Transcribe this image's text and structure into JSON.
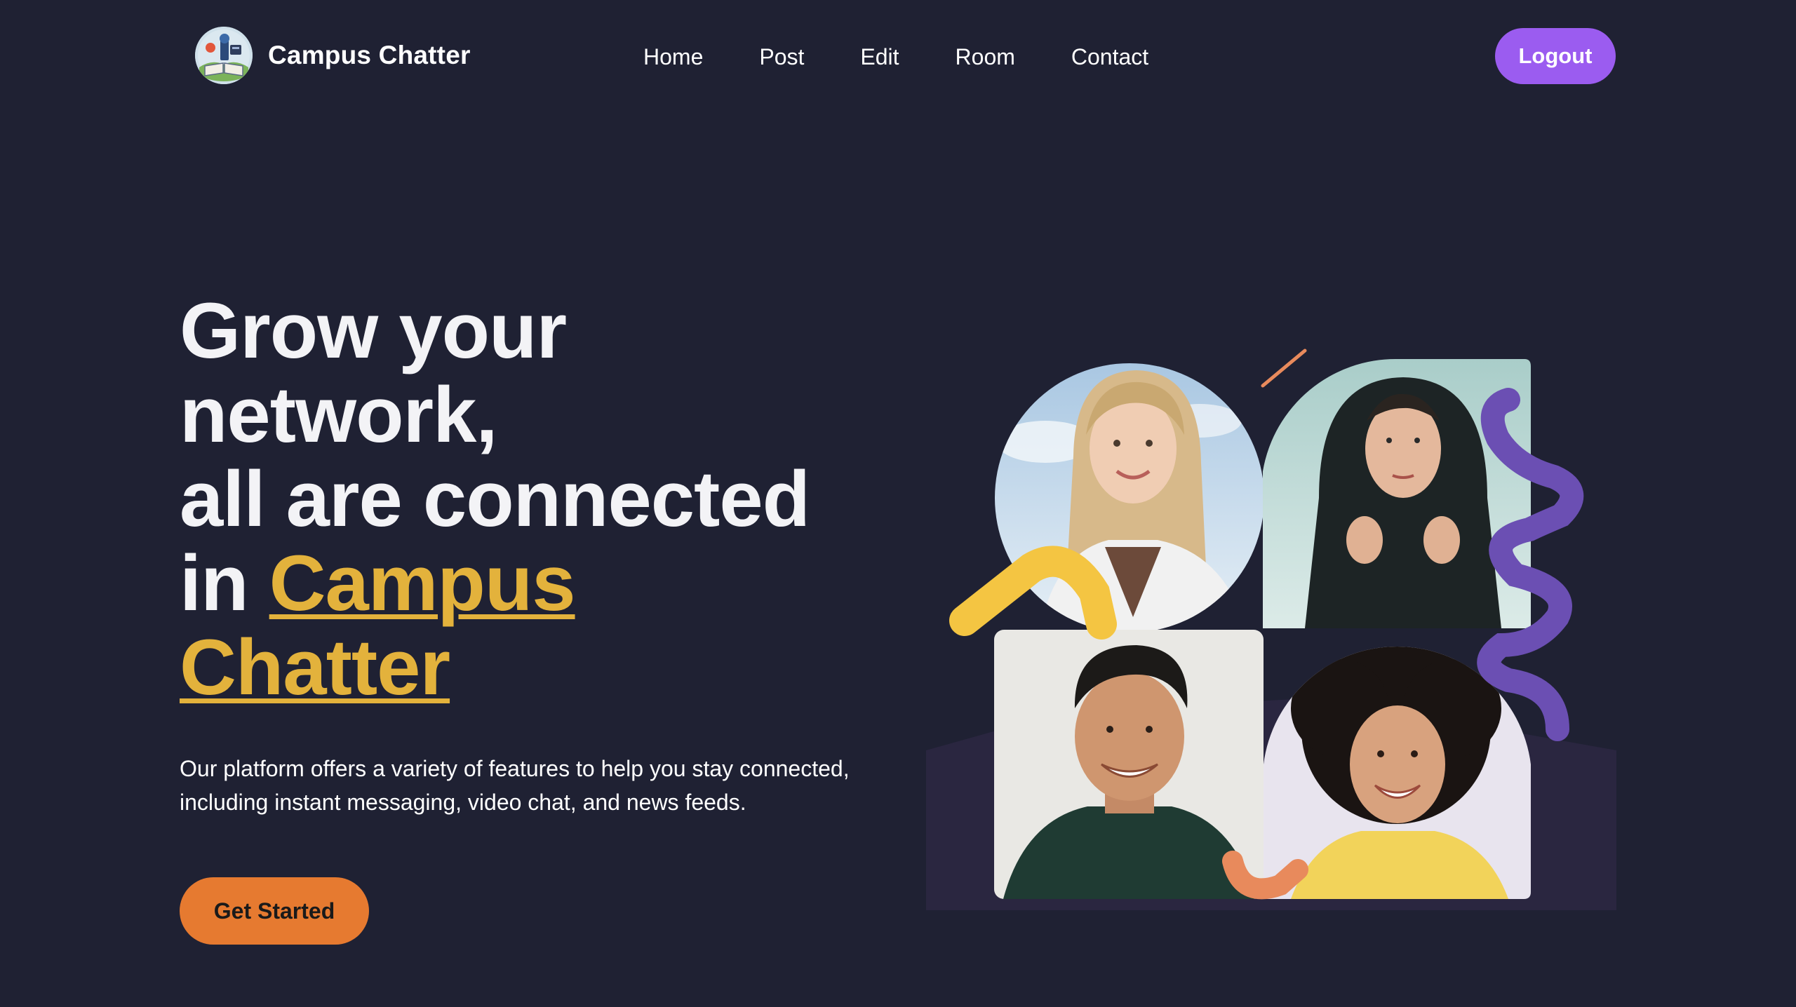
{
  "brand": {
    "name": "Campus Chatter",
    "logo_icon": "campus-book-logo-icon"
  },
  "nav": {
    "items": [
      {
        "label": "Home"
      },
      {
        "label": "Post"
      },
      {
        "label": "Edit"
      },
      {
        "label": "Room"
      },
      {
        "label": "Contact"
      }
    ]
  },
  "header": {
    "logout_label": "Logout"
  },
  "hero": {
    "title_line1": "Grow your",
    "title_line2": "network,",
    "title_line3": "all are connected",
    "title_prefix": "in ",
    "title_highlight_1": "Campus",
    "title_highlight_2": "Chatter",
    "description_line1": "Our platform offers a variety of features to help you stay connected,",
    "description_line2": "including instant messaging, video chat, and news feeds.",
    "cta_label": "Get Started"
  },
  "colors": {
    "background": "#1f2133",
    "accent_purple": "#9b5cf0",
    "accent_yellow": "#e3b23c",
    "accent_orange": "#e67a30",
    "shape_purple": "#6b4fb3",
    "shape_yellow": "#f4c542",
    "shape_coral": "#e88a5c"
  }
}
